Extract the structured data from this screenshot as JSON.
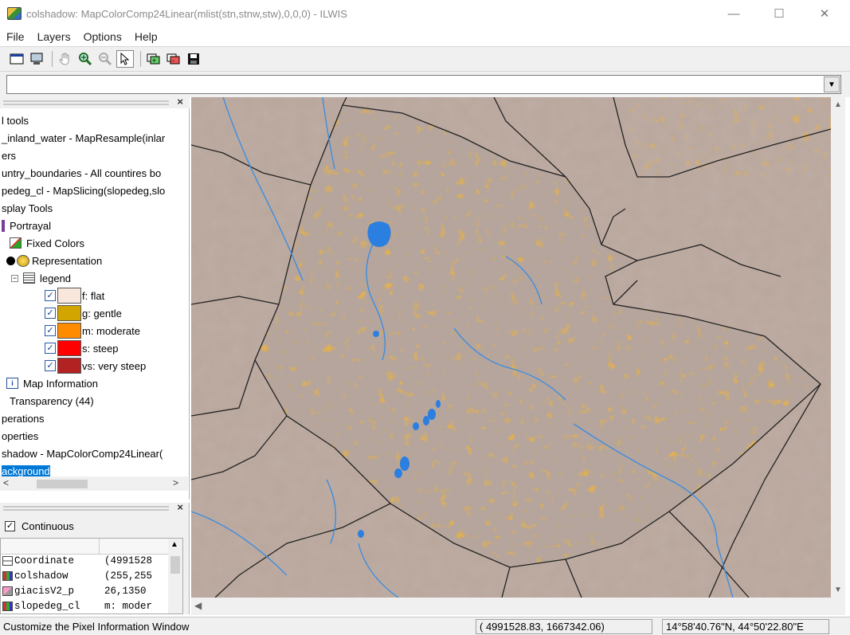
{
  "window": {
    "title": "colshadow: MapColorComp24Linear(mlist(stn,stnw,stw),0,0,0) - ILWIS",
    "minimize": "—",
    "maximize": "☐",
    "close": "✕"
  },
  "menu": [
    "File",
    "Layers",
    "Options",
    "Help"
  ],
  "command_line": {
    "value": ""
  },
  "layer_panel": {
    "close": "×",
    "items": [
      {
        "label": "l tools",
        "indent": 0
      },
      {
        "label": "_inland_water - MapResample(inlar",
        "indent": 0
      },
      {
        "label": "ers",
        "indent": 0
      },
      {
        "label": "untry_boundaries - All countires bo",
        "indent": 0
      },
      {
        "label": "pedeg_cl - MapSlicing(slopedeg,slo",
        "indent": 0
      },
      {
        "label": "splay Tools",
        "indent": 0
      },
      {
        "label": "Portrayal",
        "indent": 1
      },
      {
        "label": "Fixed Colors",
        "indent": 2
      },
      {
        "label": "Representation",
        "indent": 2
      },
      {
        "label": "legend",
        "indent": 3
      },
      {
        "label": "Map Information",
        "indent": 1
      },
      {
        "label": "Transparency (44)",
        "indent": 1
      },
      {
        "label": "perations",
        "indent": 0
      },
      {
        "label": "operties",
        "indent": 0
      },
      {
        "label": "shadow - MapColorComp24Linear(",
        "indent": 0
      },
      {
        "label": "ackground",
        "indent": 0
      }
    ],
    "legend": [
      {
        "label": "f: flat",
        "color": "#f8e7dc"
      },
      {
        "label": "g: gentle",
        "color": "#d2a500"
      },
      {
        "label": "m: moderate",
        "color": "#ff8c00"
      },
      {
        "label": "s: steep",
        "color": "#ff0000"
      },
      {
        "label": "vs: very steep",
        "color": "#b22222"
      }
    ],
    "scroll_left": "<",
    "scroll_right": ">"
  },
  "pixel_info": {
    "close": "×",
    "continuous_label": "Continuous",
    "continuous_checked": true,
    "rows": [
      {
        "name": "Coordinate",
        "value": "(4991528"
      },
      {
        "name": "colshadow",
        "value": "(255,255"
      },
      {
        "name": "giacisV2_p",
        "value": "26,1350"
      },
      {
        "name": "slopedeg_cl",
        "value": "m: moder"
      }
    ]
  },
  "status": {
    "message": "Customize the Pixel Information Window",
    "coordinates": "( 4991528.83,  1667342.06)",
    "latlon": "14°58'40.76\"N, 44°50'22.80\"E"
  },
  "colors": {
    "selection": "#0078d7",
    "map_background": "#b9a79c",
    "water": "#2b7fe0",
    "boundary": "#222222"
  }
}
